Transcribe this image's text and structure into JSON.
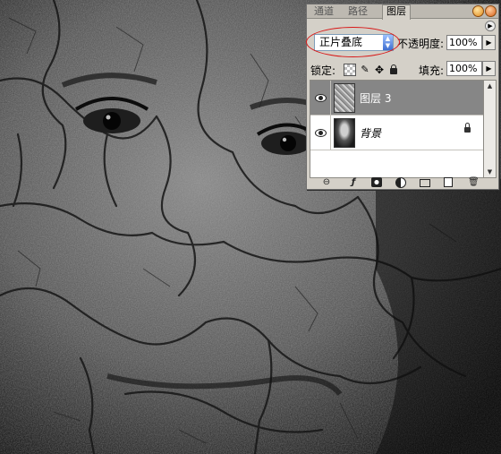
{
  "tabs": [
    {
      "label": "通道",
      "active": false
    },
    {
      "label": "路径",
      "active": false
    },
    {
      "label": "图层",
      "active": true
    }
  ],
  "blend_mode": {
    "value": "正片叠底",
    "highlighted": true
  },
  "opacity": {
    "label": "不透明度:",
    "value": "100%"
  },
  "lock": {
    "label": "锁定:"
  },
  "fill": {
    "label": "填充:",
    "value": "100%"
  },
  "layers": [
    {
      "name": "图层 3",
      "visible": true,
      "selected": true,
      "locked": false
    },
    {
      "name": "背景",
      "visible": true,
      "selected": false,
      "locked": true
    }
  ],
  "bottom_icons": [
    "link-icon",
    "layer-style-icon",
    "layer-mask-icon",
    "adjustment-layer-icon",
    "new-group-icon",
    "new-layer-icon",
    "delete-layer-icon"
  ],
  "colors": {
    "highlight_oval": "#d81818",
    "selected_layer": "#868686",
    "palette_bg": "#d4d0c8"
  }
}
